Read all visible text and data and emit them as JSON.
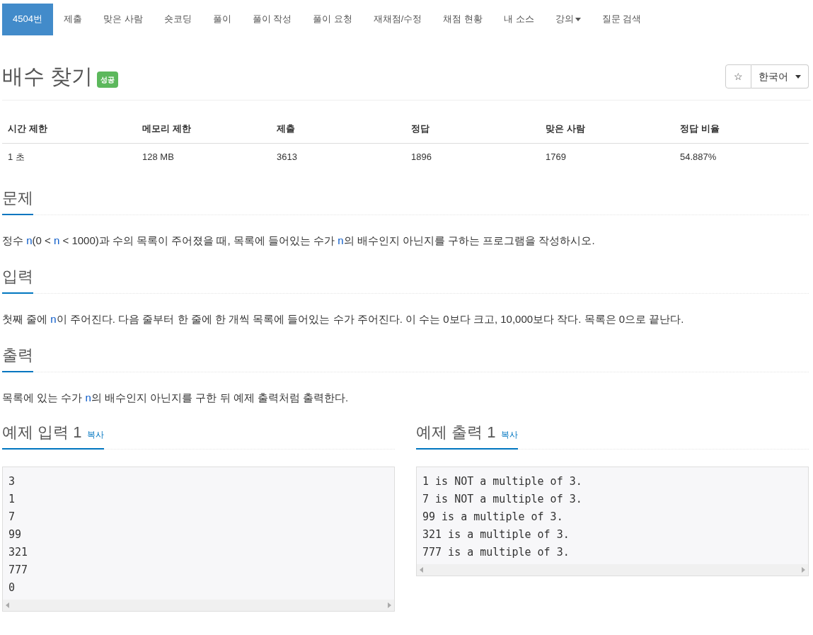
{
  "nav": [
    {
      "label": "4504번",
      "selected": true,
      "dropdown": false
    },
    {
      "label": "제출",
      "selected": false,
      "dropdown": false
    },
    {
      "label": "맞은 사람",
      "selected": false,
      "dropdown": false
    },
    {
      "label": "숏코딩",
      "selected": false,
      "dropdown": false
    },
    {
      "label": "풀이",
      "selected": false,
      "dropdown": false
    },
    {
      "label": "풀이 작성",
      "selected": false,
      "dropdown": false
    },
    {
      "label": "풀이 요청",
      "selected": false,
      "dropdown": false
    },
    {
      "label": "재채점/수정",
      "selected": false,
      "dropdown": false
    },
    {
      "label": "채점 현황",
      "selected": false,
      "dropdown": false
    },
    {
      "label": "내 소스",
      "selected": false,
      "dropdown": false
    },
    {
      "label": "강의",
      "selected": false,
      "dropdown": true
    },
    {
      "label": "질문 검색",
      "selected": false,
      "dropdown": false
    }
  ],
  "title": "배수 찾기",
  "badge": "성공",
  "star": "☆",
  "language": "한국어",
  "info": {
    "columns": [
      "시간 제한",
      "메모리 제한",
      "제출",
      "정답",
      "맞은 사람",
      "정답 비율"
    ],
    "row": [
      "1 초",
      "128 MB",
      "3613",
      "1896",
      "1769",
      "54.887%"
    ]
  },
  "sections": [
    {
      "heading": "문제",
      "parts": [
        {
          "kind": "text",
          "text": "정수 "
        },
        {
          "kind": "var",
          "text": "n"
        },
        {
          "kind": "text",
          "text": "(0 < "
        },
        {
          "kind": "var",
          "text": "n"
        },
        {
          "kind": "text",
          "text": " < 1000)과 수의 목록이 주어졌을 때, 목록에 들어있는 수가 "
        },
        {
          "kind": "var",
          "text": "n"
        },
        {
          "kind": "text",
          "text": "의 배수인지 아닌지를 구하는 프로그램을 작성하시오."
        }
      ]
    },
    {
      "heading": "입력",
      "parts": [
        {
          "kind": "text",
          "text": "첫째 줄에 "
        },
        {
          "kind": "var",
          "text": "n"
        },
        {
          "kind": "text",
          "text": "이 주어진다. 다음 줄부터 한 줄에 한 개씩 목록에 들어있는 수가 주어진다. 이 수는 0보다 크고, 10,000보다 작다. 목록은 0으로 끝난다."
        }
      ]
    },
    {
      "heading": "출력",
      "parts": [
        {
          "kind": "text",
          "text": "목록에 있는 수가 "
        },
        {
          "kind": "var",
          "text": "n"
        },
        {
          "kind": "text",
          "text": "의 배수인지 아닌지를 구한 뒤 예제 출력처럼 출력한다."
        }
      ]
    }
  ],
  "samples": [
    {
      "heading": "예제 입력 1",
      "copy": "복사",
      "lines": [
        "3",
        "1",
        "7",
        "99",
        "321",
        "777",
        "0"
      ]
    },
    {
      "heading": "예제 출력 1",
      "copy": "복사",
      "lines": [
        "1 is NOT a multiple of 3.",
        "7 is NOT a multiple of 3.",
        "99 is a multiple of 3.",
        "321 is a multiple of 3.",
        "777 is a multiple of 3."
      ]
    }
  ]
}
